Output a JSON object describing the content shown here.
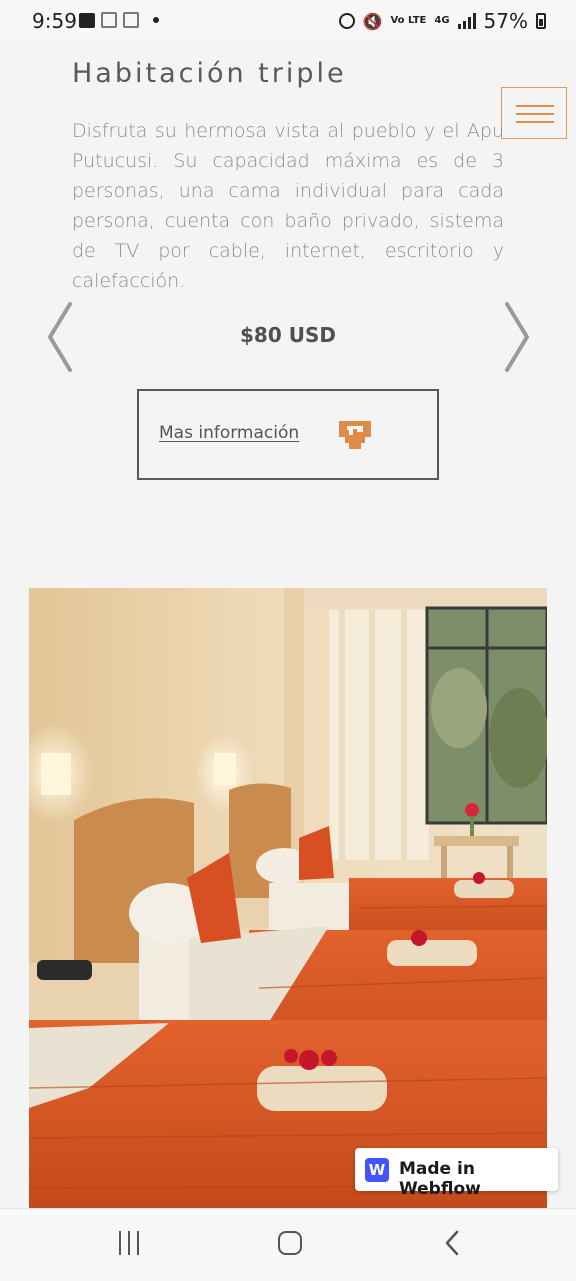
{
  "status_bar": {
    "time": "9:59",
    "battery": "57%",
    "network": "4G",
    "volte": "Vo LTE"
  },
  "room": {
    "title": "Habitación triple",
    "description": "Disfruta su hermosa vista al pueblo y el Apu Putucusi. Su capacidad máxima es de 3 personas, una cama individual  para cada persona, cuenta con baño privado, sistema de TV por cable, internet, escritorio y calefacción.",
    "price": "$80 USD",
    "more_info_label": "Mas información",
    "image_alt": "Habitación triple con tres camas y cubrecamas naranjas"
  },
  "webflow_badge": {
    "logo_letter": "W",
    "label": "Made in Webflow"
  },
  "colors": {
    "accent": "#e08c49",
    "background": "#f4f4f4",
    "webflow_blue": "#4353ff"
  },
  "icons": {
    "menu": "hamburger-icon",
    "prev": "chevron-left-icon",
    "next": "chevron-right-icon",
    "info": "inca-pattern-icon"
  }
}
